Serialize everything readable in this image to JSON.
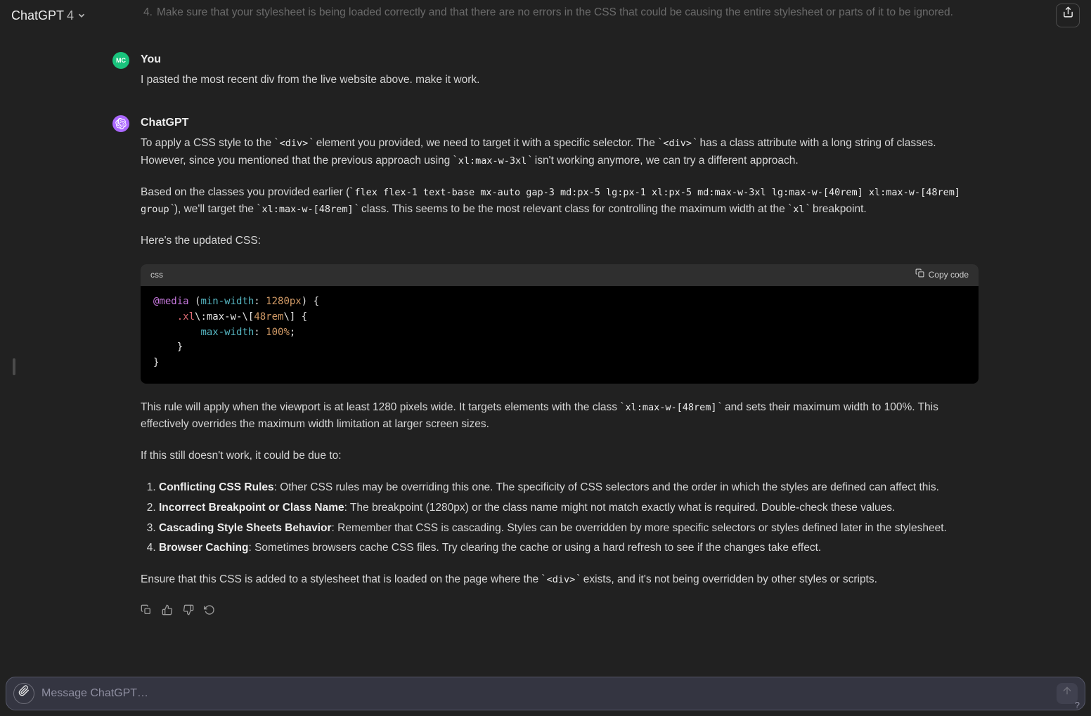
{
  "header": {
    "model_name": "ChatGPT",
    "model_version": "4"
  },
  "prior_line": {
    "index": "4.",
    "text": "Make sure that your stylesheet is being loaded correctly and that there are no errors in the CSS that could be causing the entire stylesheet or parts of it to be ignored."
  },
  "user_turn": {
    "name": "You",
    "avatar_initials": "MC",
    "text": "I pasted the most recent div from the live website above. make it work."
  },
  "assistant_turn": {
    "name": "ChatGPT",
    "para1_a": "To apply a CSS style to the ",
    "para1_code1": "<div>",
    "para1_b": " element you provided, we need to target it with a specific selector. The ",
    "para1_code2": "<div>",
    "para1_c": " has a class attribute with a long string of classes. However, since you mentioned that the previous approach using ",
    "para1_code3": "xl:max-w-3xl",
    "para1_d": " isn't working anymore, we can try a different approach.",
    "para2_a": "Based on the classes you provided earlier (",
    "para2_code1": "flex flex-1 text-base mx-auto gap-3 md:px-5 lg:px-1 xl:px-5 md:max-w-3xl lg:max-w-[40rem] xl:max-w-[48rem] group",
    "para2_b": "), we'll target the ",
    "para2_code2": "xl:max-w-[48rem]",
    "para2_c": " class. This seems to be the most relevant class for controlling the maximum width at the ",
    "para2_code3": "xl",
    "para2_d": " breakpoint.",
    "para3": "Here's the updated CSS:",
    "code_lang": "css",
    "copy_label": "Copy code",
    "code": {
      "l1_at": "@media",
      "l1_open": " (",
      "l1_prop": "min-width",
      "l1_colon": ":",
      "l1_val": " 1280px",
      "l1_close": ") {",
      "l2_indent": "    ",
      "l2_sel": ".xl",
      "l2_esc": "\\:max-w-\\[",
      "l2_num": "48rem",
      "l2_esc2": "\\] {",
      "l3_indent": "        ",
      "l3_prop": "max-width",
      "l3_colon": ":",
      "l3_val": " 100%",
      "l3_semi": ";",
      "l4": "    }",
      "l5": "}"
    },
    "para4_a": "This rule will apply when the viewport is at least 1280 pixels wide. It targets elements with the class ",
    "para4_code1": "xl:max-w-[48rem]",
    "para4_b": " and sets their maximum width to 100%. This effectively overrides the maximum width limitation at larger screen sizes.",
    "para5": "If this still doesn't work, it could be due to:",
    "reasons": [
      {
        "title": "Conflicting CSS Rules",
        "rest": ": Other CSS rules may be overriding this one. The specificity of CSS selectors and the order in which the styles are defined can affect this."
      },
      {
        "title": "Incorrect Breakpoint or Class Name",
        "rest": ": The breakpoint (1280px) or the class name might not match exactly what is required. Double-check these values."
      },
      {
        "title": "Cascading Style Sheets Behavior",
        "rest": ": Remember that CSS is cascading. Styles can be overridden by more specific selectors or styles defined later in the stylesheet."
      },
      {
        "title": "Browser Caching",
        "rest": ": Sometimes browsers cache CSS files. Try clearing the cache or using a hard refresh to see if the changes take effect."
      }
    ],
    "para6_a": "Ensure that this CSS is added to a stylesheet that is loaded on the page where the ",
    "para6_code1": "<div>",
    "para6_b": " exists, and it's not being overridden by other styles or scripts."
  },
  "composer": {
    "placeholder": "Message ChatGPT…"
  },
  "help_badge": "?"
}
